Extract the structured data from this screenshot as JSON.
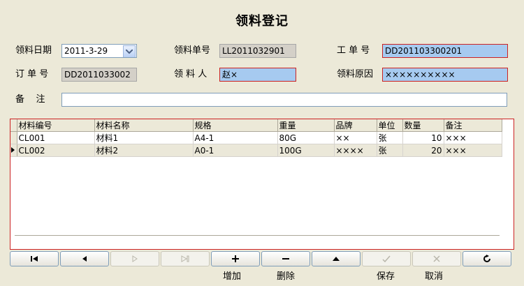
{
  "title": "领料登记",
  "form": {
    "date_label": "领料日期",
    "date_value": "2011-3-29",
    "slip_label": "领料单号",
    "slip_value": "LL2011032901",
    "job_label": "工 单 号",
    "job_value": "DD201103300201",
    "order_label": "订 单 号",
    "order_value": "DD2011033002",
    "person_label": "领 料 人",
    "person_value": "赵×",
    "reason_label": "领料原因",
    "reason_value": "××××××××××",
    "remark_label": "备    注",
    "remark_value": ""
  },
  "grid": {
    "columns": [
      "材料编号",
      "材料名称",
      "规格",
      "重量",
      "品牌",
      "单位",
      "数量",
      "备注"
    ],
    "rows": [
      [
        "CL001",
        "材料1",
        "A4-1",
        "80G",
        "××",
        "张",
        "10",
        "×××"
      ],
      [
        "CL002",
        "材料2",
        "A0-1",
        "100G",
        "××××",
        "张",
        "20",
        "×××"
      ]
    ]
  },
  "toolbar": {
    "add_label": "增加",
    "delete_label": "删除",
    "save_label": "保存",
    "cancel_label": "取消"
  }
}
